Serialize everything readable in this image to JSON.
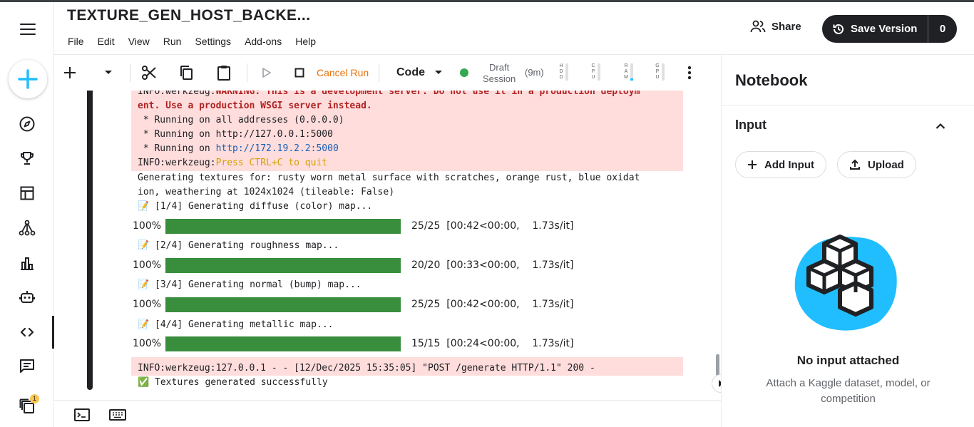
{
  "notebook": {
    "title": "TEXTURE_GEN_HOST_BACKE..."
  },
  "menu": [
    "File",
    "Edit",
    "View",
    "Run",
    "Settings",
    "Add-ons",
    "Help"
  ],
  "header": {
    "share_label": "Share",
    "save_label": "Save Version",
    "save_count": "0"
  },
  "rail": {
    "notification_count": "1"
  },
  "toolbar": {
    "cancel_label": "Cancel Run",
    "cell_type": "Code",
    "session_line1": "Draft",
    "session_line2": "Session",
    "session_time": "(9m)",
    "meters": [
      "HDD",
      "CPU",
      "RAM",
      "GPU"
    ],
    "status_color": "#34a853"
  },
  "output": {
    "l1_prefix": "INFO:werkzeug:",
    "l1_warn": "WARNING: This is a development server. Do not use it in a production deploym",
    "l2": "ent. Use a production WSGI server instead.",
    "l3": " * Running on all addresses (0.0.0.0)",
    "l4": " * Running on http://127.0.0.1:5000",
    "l5_prefix": " * Running on ",
    "l5_link": "http://172.19.2.2:5000",
    "l6_prefix": "INFO:werkzeug:",
    "l6_msg": "Press CTRL+C to quit",
    "gen1": "Generating textures for: rusty worn metal surface with scratches, orange rust, blue oxidat",
    "gen2": "ion, weathering at 1024x1024 (tileable: False)",
    "step1": "📝 [1/4] Generating diffuse (color) map...",
    "step2": "📝 [2/4] Generating roughness map...",
    "step3": "📝 [3/4] Generating normal (bump) map...",
    "step4": "📝 [4/4] Generating metallic map...",
    "post": "INFO:werkzeug:127.0.0.1 - - [12/Dec/2025 15:35:05] \"POST /generate HTTP/1.1\" 200 -",
    "done": "✅ Textures generated successfully",
    "progress": [
      {
        "pct": "100%",
        "fraction": 1.0,
        "stats": "25/25  [00:42<00:00,    1.73s/it]"
      },
      {
        "pct": "100%",
        "fraction": 1.0,
        "stats": "20/20  [00:33<00:00,    1.73s/it]"
      },
      {
        "pct": "100%",
        "fraction": 1.0,
        "stats": "25/25  [00:42<00:00,    1.73s/it]"
      },
      {
        "pct": "100%",
        "fraction": 1.0,
        "stats": "15/15  [00:24<00:00,    1.73s/it]"
      }
    ]
  },
  "panel": {
    "title": "Notebook",
    "section": "Input",
    "add_input": "Add Input",
    "upload": "Upload",
    "empty_title": "No input attached",
    "empty_sub": "Attach a Kaggle dataset, model, or competition",
    "accent": "#20beff"
  }
}
